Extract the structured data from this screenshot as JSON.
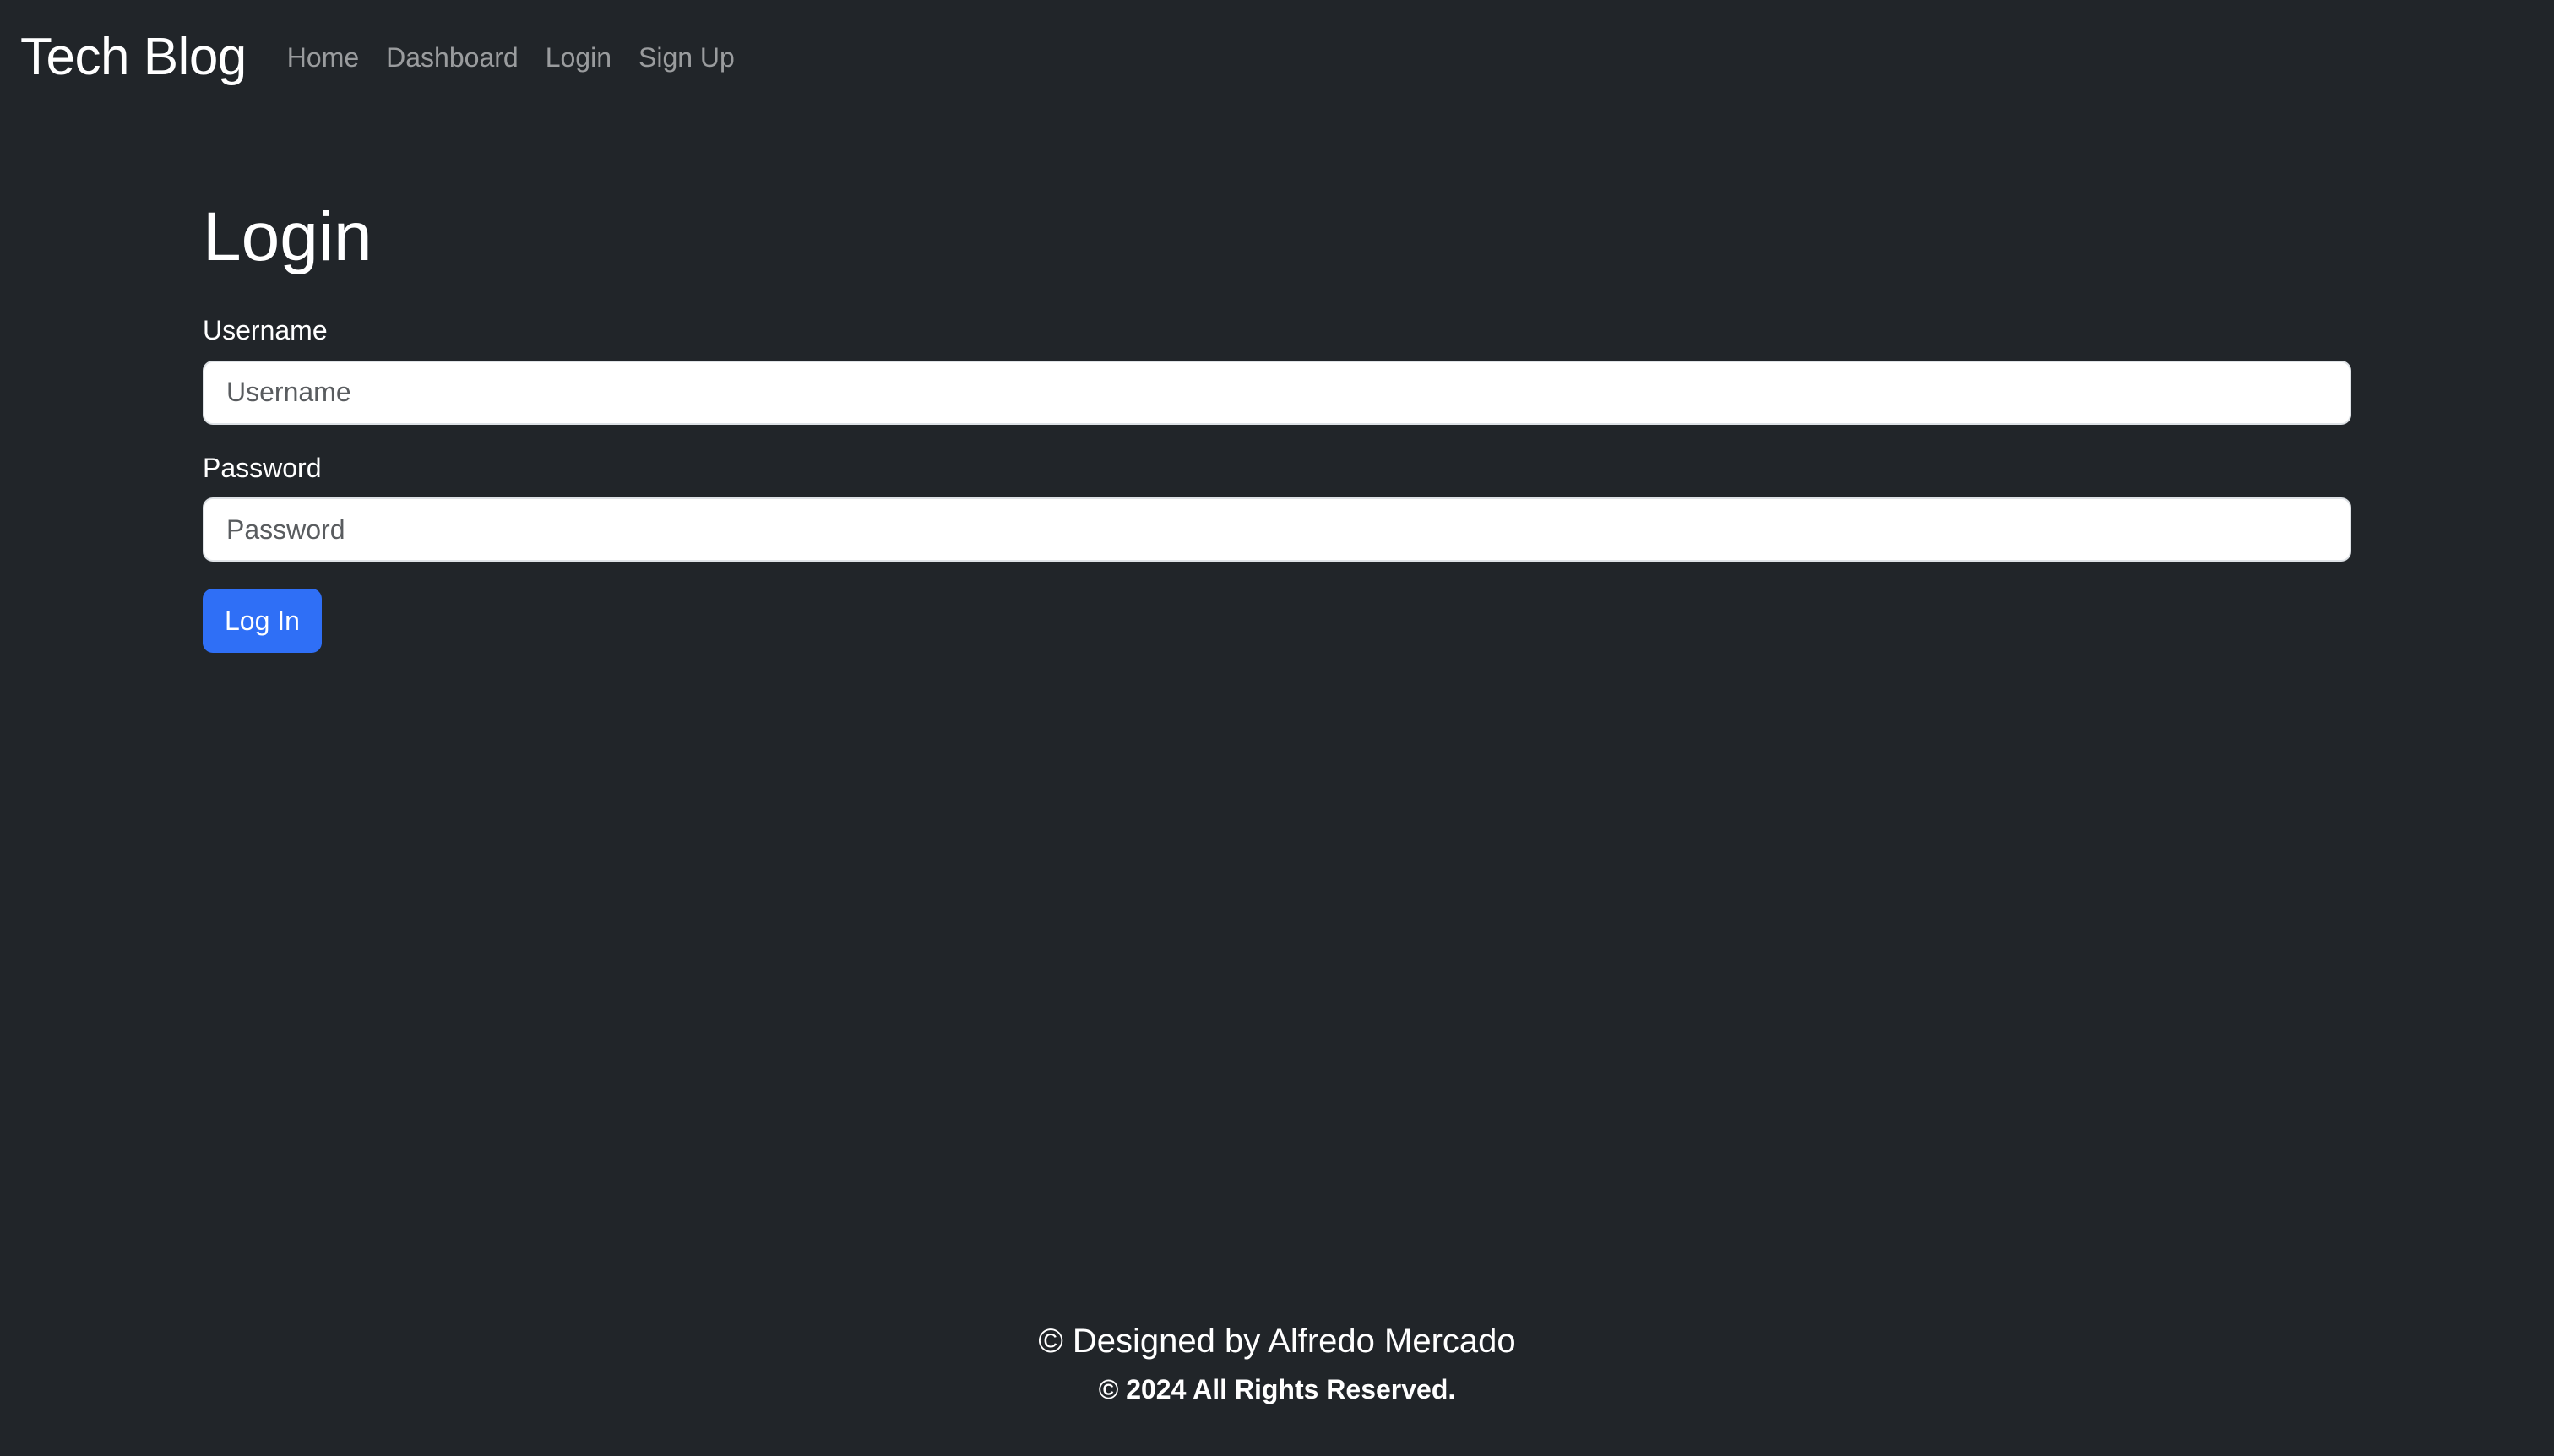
{
  "navbar": {
    "brand": "Tech Blog",
    "links": [
      {
        "label": "Home"
      },
      {
        "label": "Dashboard"
      },
      {
        "label": "Login"
      },
      {
        "label": "Sign Up"
      }
    ]
  },
  "main": {
    "title": "Login",
    "username": {
      "label": "Username",
      "value": "",
      "placeholder": "Username"
    },
    "password": {
      "label": "Password",
      "value": "",
      "placeholder": "Password"
    },
    "submit_label": "Log In"
  },
  "footer": {
    "credit": "© Designed by Alfredo Mercado",
    "rights": "© 2024 All Rights Reserved."
  },
  "colors": {
    "background": "#212529",
    "primary": "#2f6ff6",
    "nav_link": "rgba(255,255,255,0.55)",
    "text": "#ffffff"
  }
}
